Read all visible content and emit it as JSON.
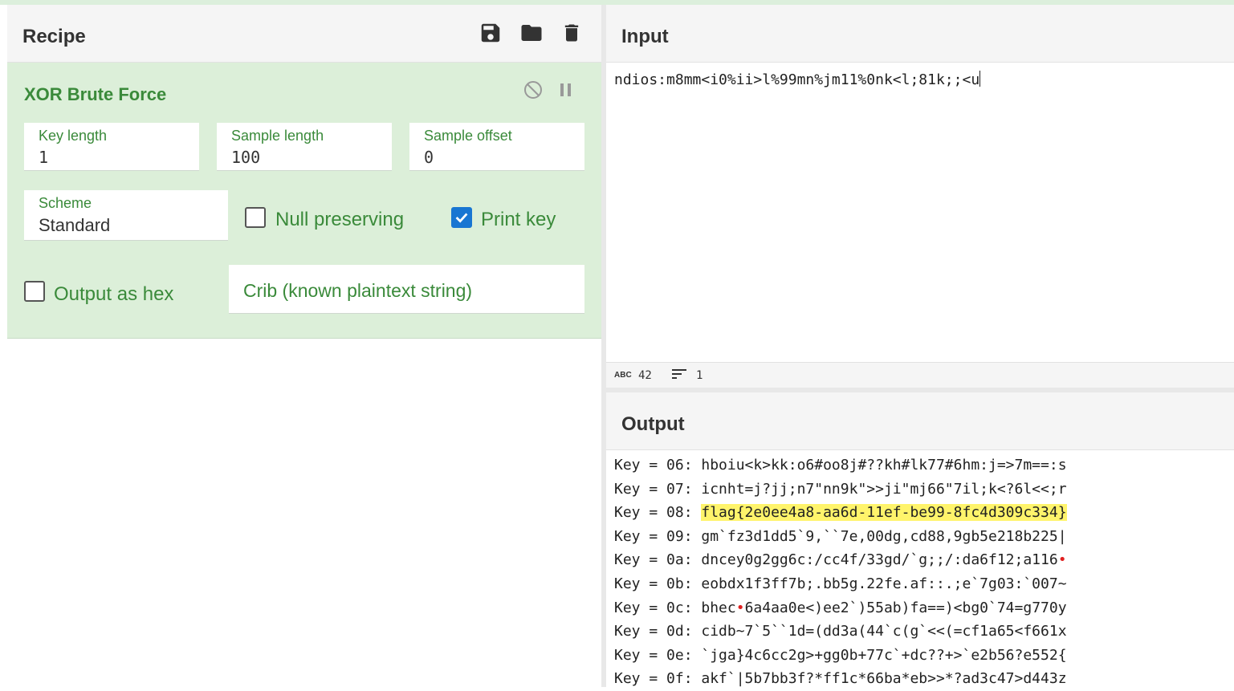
{
  "recipe": {
    "title": "Recipe",
    "icons": [
      "save-icon",
      "folder-icon",
      "trash-icon"
    ],
    "operation": {
      "name": "XOR Brute Force",
      "fields": {
        "key_length": {
          "label": "Key length",
          "value": "1"
        },
        "sample_length": {
          "label": "Sample length",
          "value": "100"
        },
        "sample_offset": {
          "label": "Sample offset",
          "value": "0"
        },
        "scheme": {
          "label": "Scheme",
          "value": "Standard"
        }
      },
      "checkboxes": {
        "null_preserving": {
          "label": "Null preserving",
          "checked": false
        },
        "print_key": {
          "label": "Print key",
          "checked": true
        },
        "output_as_hex": {
          "label": "Output as hex",
          "checked": false
        }
      },
      "crib_placeholder": "Crib (known plaintext string)"
    }
  },
  "input": {
    "title": "Input",
    "text": "ndios:m8mm<i0%ii>l%99mn%jm11%0nk<l;81k;;<u",
    "status": {
      "chars": "42",
      "lines": "1"
    }
  },
  "output": {
    "title": "Output",
    "lines": [
      {
        "key": "Key = 06: ",
        "text": "hboiu<k>kk:o6#oo8j#??kh#lk77#6hm:j=>7m==:s"
      },
      {
        "key": "Key = 07: ",
        "text": "icnht=j?jj;n7\"nn9k\">>ji\"mj66\"7il;k<?6l<<;r"
      },
      {
        "key": "Key = 08: ",
        "text": "flag{2e0ee4a8-aa6d-11ef-be99-8fc4d309c334}"
      },
      {
        "key": "Key = 09: ",
        "text": "gm`fz3d1dd5`9,``7e,00dg,cd88,9gb5e218b225|"
      },
      {
        "key": "Key = 0a: ",
        "text": "dncey0g2gg6c:/cc4f/33gd/`g;;/:da6f12;a116"
      },
      {
        "key": "Key = 0b: ",
        "text": "eobdx1f3ff7b;.bb5g.22fe.af::.;e`7g03:`007~"
      },
      {
        "key": "Key = 0c: ",
        "text_a": "bhec",
        "text_b": "6a4aa0e<)ee2`)55ab)fa==)<bg0`74=g770y"
      },
      {
        "key": "Key = 0d: ",
        "text": "cidb~7`5``1d=(dd3a(44`c(g`<<(=cf1a65<f661x"
      },
      {
        "key": "Key = 0e: ",
        "text": "`jga}4c6cc2g>+gg0b+77c`+dc??+>`e2b56?e552{"
      },
      {
        "key": "Key = 0f: ",
        "text": "akf`|5b7bb3f?*ff1c*66ba*eb>>*?ad3c47>d443z"
      }
    ]
  }
}
